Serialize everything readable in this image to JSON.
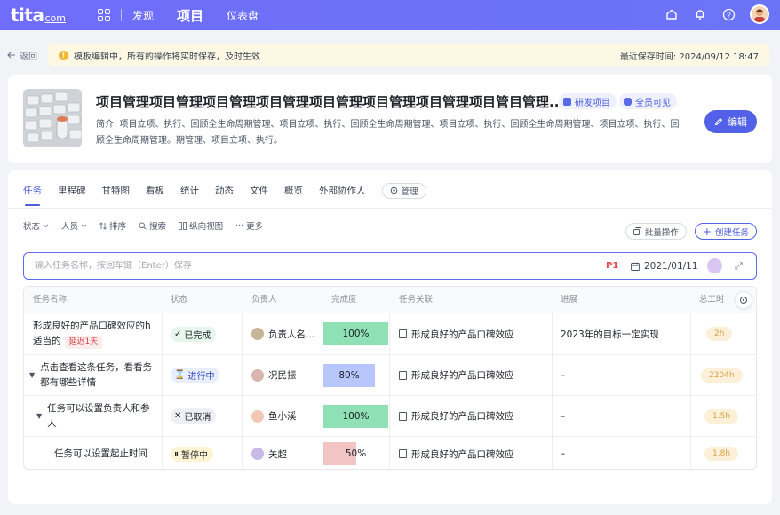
{
  "nav": {
    "brand": "tita",
    "brand_domain": "com",
    "items": [
      {
        "label": "发现",
        "active": false
      },
      {
        "label": "项目",
        "active": true
      },
      {
        "label": "仪表盘",
        "active": false
      }
    ]
  },
  "back_label": "返回",
  "notice": {
    "message": "模板编辑中，所有的操作将实时保存，及时生效",
    "saved": "最近保存时间: 2024/09/12 18:47"
  },
  "project": {
    "title": "项目管理项目管理项目管理项目管理项目管理项目管理项目管理项目管目管理...",
    "tags": [
      "研发项目",
      "全员可见"
    ],
    "description": "简介: 项目立项、执行、回顾全生命周期管理、项目立项、执行、回顾全生命周期管理、项目立项、执行、回顾全生命周期管理、项目立项、执行、回顾全生命周期管理。期管理、项目立项、执行。",
    "edit_label": "编辑"
  },
  "tabs": [
    "任务",
    "里程碑",
    "甘特图",
    "看板",
    "统计",
    "动态",
    "文件",
    "概览",
    "外部协作人"
  ],
  "active_tab": "任务",
  "manage_label": "管理",
  "toolbar": {
    "filters": [
      "状态",
      "人员",
      "排序",
      "搜索",
      "纵向视图",
      "更多"
    ],
    "batch_label": "批量操作",
    "create_label": "创建任务"
  },
  "quick_add": {
    "placeholder": "输入任务名称，按回车键（Enter）保存",
    "priority": "P1",
    "date": "2021/01/11"
  },
  "columns": [
    "任务名称",
    "状态",
    "负责人",
    "完成度",
    "任务关联",
    "进展",
    "总工时"
  ],
  "colors": {
    "accent": "#5361e8",
    "done": "#8fe0b4",
    "progress_blue": "#b7c6fb",
    "progress_low": "#f2c4c4"
  },
  "rows": [
    {
      "name": "形成良好的产品口碑效应的h适当的",
      "delay": "延迟1天",
      "status": "已完成",
      "status_type": "done",
      "owner": "负责人名...",
      "progress": 100,
      "progress_label": "100%",
      "relation": "形成良好的产品口碑效应",
      "note": "2023年的目标一定实现",
      "hours": "2h",
      "indent": 0,
      "expandable": false
    },
    {
      "name": "点击查看这条任务，看看务都有哪些详情",
      "delay": "",
      "status": "进行中",
      "status_type": "prog",
      "owner": "况民振",
      "progress": 80,
      "progress_label": "80%",
      "relation": "形成良好的产品口碑效应",
      "note": "–",
      "hours": "2204h",
      "indent": 0,
      "expandable": true
    },
    {
      "name": "任务可以设置负责人和参人",
      "delay": "",
      "status": "已取消",
      "status_type": "cancel",
      "owner": "鱼小溪",
      "progress": 100,
      "progress_label": "100%",
      "relation": "形成良好的产品口碑效应",
      "note": "–",
      "hours": "1.5h",
      "indent": 1,
      "expandable": true
    },
    {
      "name": "任务可以设置起止时间",
      "delay": "",
      "status": "暂停中",
      "status_type": "pause",
      "owner": "关超",
      "progress": 50,
      "progress_label": "50%",
      "relation": "形成良好的产品口碑效应",
      "note": "–",
      "hours": "1.8h",
      "indent": 2,
      "expandable": false
    }
  ]
}
